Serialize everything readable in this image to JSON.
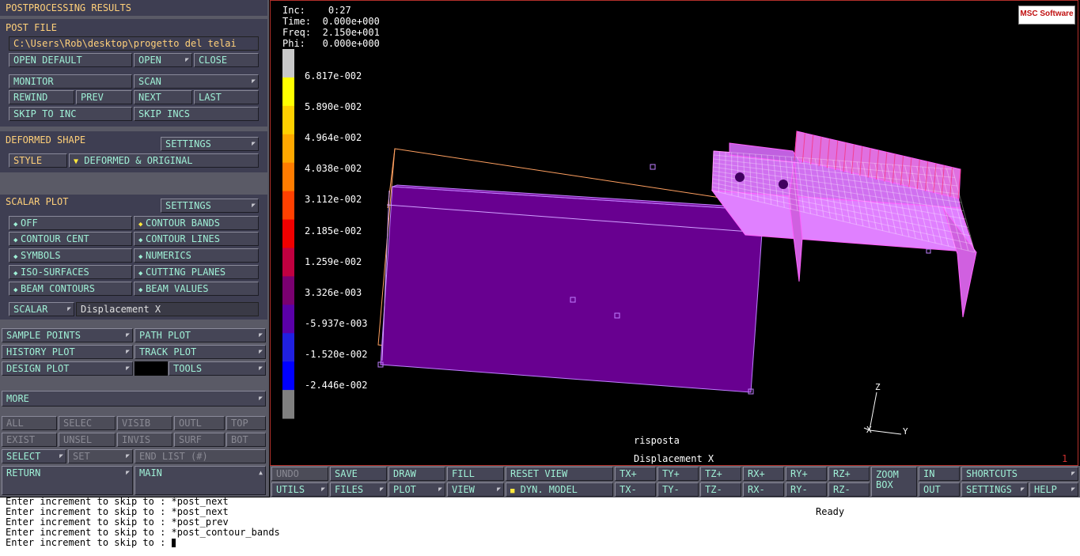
{
  "panel_title": "POSTPROCESSING RESULTS",
  "post_file": {
    "header": "POST FILE",
    "path": "C:\\Users\\Rob\\desktop\\progetto del telai",
    "open_default": "OPEN DEFAULT",
    "open": "OPEN",
    "close": "CLOSE",
    "monitor": "MONITOR",
    "scan": "SCAN",
    "rewind": "REWIND",
    "prev": "PREV",
    "next": "NEXT",
    "last": "LAST",
    "skip_to_inc": "SKIP TO INC",
    "skip_incs": "SKIP INCS"
  },
  "deformed_shape": {
    "header": "DEFORMED SHAPE",
    "settings": "SETTINGS",
    "style_label": "STYLE",
    "style_value": "DEFORMED & ORIGINAL"
  },
  "scalar_plot": {
    "header": "SCALAR PLOT",
    "settings": "SETTINGS",
    "options": [
      "OFF",
      "CONTOUR BANDS",
      "CONTOUR CENT",
      "CONTOUR LINES",
      "SYMBOLS",
      "NUMERICS",
      "ISO-SURFACES",
      "CUTTING PLANES",
      "BEAM CONTOURS",
      "BEAM VALUES"
    ],
    "selected": "CONTOUR BANDS",
    "scalar_label": "SCALAR",
    "scalar_value": "Displacement X"
  },
  "plots": {
    "sample_points": "SAMPLE POINTS",
    "path_plot": "PATH PLOT",
    "history_plot": "HISTORY PLOT",
    "track_plot": "TRACK PLOT",
    "design_plot": "DESIGN PLOT",
    "tools": "TOOLS"
  },
  "more": "MORE",
  "select_grid": {
    "row1": [
      "ALL",
      "SELEC",
      "VISIB",
      "OUTL",
      "TOP"
    ],
    "row2": [
      "EXIST",
      "UNSEL",
      "INVIS",
      "SURF",
      "BOT"
    ],
    "select": "SELECT",
    "set": "SET",
    "end_list": "END LIST (#)",
    "return": "RETURN",
    "main": "MAIN"
  },
  "viewport": {
    "inc_label": "Inc:",
    "inc_value": "0:27",
    "time_label": "Time:",
    "time_value": "0.000e+000",
    "freq_label": "Freq:",
    "freq_value": "2.150e+001",
    "phi_label": "Phi:",
    "phi_value": "0.000e+000",
    "legend_values": [
      "6.817e-002",
      "5.890e-002",
      "4.964e-002",
      "4.038e-002",
      "3.112e-002",
      "2.185e-002",
      "1.259e-002",
      "3.326e-003",
      "-5.937e-003",
      "-1.520e-002",
      "-2.446e-002"
    ],
    "legend_colors": [
      "#c8c8c8",
      "#ffff00",
      "#ffd000",
      "#ffa800",
      "#ff7c00",
      "#ff4000",
      "#f00000",
      "#c00040",
      "#7a0070",
      "#5a00a8",
      "#2020e0",
      "#0000ff",
      "#808080"
    ],
    "job_name": "risposta",
    "scalar_name": "Displacement X",
    "window_id": "1",
    "axis_z": "Z",
    "axis_y": "Y",
    "axis_x": "X",
    "logo": "MSC Software"
  },
  "toolbar": {
    "undo": "UNDO",
    "save": "SAVE",
    "draw": "DRAW",
    "fill": "FILL",
    "reset_view": "RESET VIEW",
    "tx_plus": "TX+",
    "ty_plus": "TY+",
    "tz_plus": "TZ+",
    "rx_plus": "RX+",
    "ry_plus": "RY+",
    "rz_plus": "RZ+",
    "zoom_box": "ZOOM BOX",
    "in": "IN",
    "shortcuts": "SHORTCUTS",
    "utils": "UTILS",
    "files": "FILES",
    "plot": "PLOT",
    "view": "VIEW",
    "dyn_model": "DYN. MODEL",
    "tx_minus": "TX-",
    "ty_minus": "TY-",
    "tz_minus": "TZ-",
    "rx_minus": "RX-",
    "ry_minus": "RY-",
    "rz_minus": "RZ-",
    "out": "OUT",
    "settings": "SETTINGS",
    "help": "HELP"
  },
  "console": {
    "lines": [
      "Enter increment to skip to : *post_next",
      "Enter increment to skip to : *post_next",
      "Enter increment to skip to : *post_prev",
      "Enter increment to skip to : *post_contour_bands",
      "Enter increment to skip to : "
    ],
    "status": "Ready"
  }
}
